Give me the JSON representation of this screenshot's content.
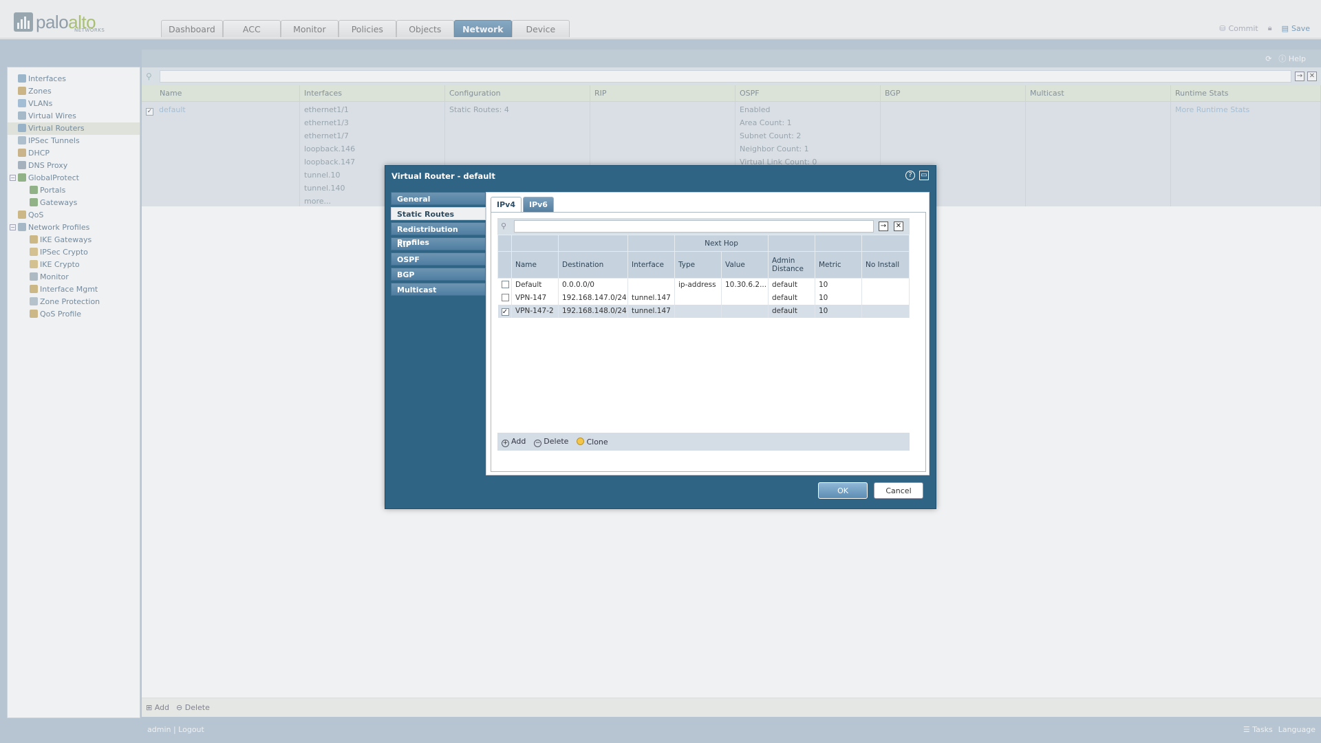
{
  "header": {
    "logo_word_a": "palo",
    "logo_word_b": "alto",
    "logo_sub": "NETWORKS",
    "tabs": [
      "Dashboard",
      "ACC",
      "Monitor",
      "Policies",
      "Objects",
      "Network",
      "Device"
    ],
    "active_tab": "Network",
    "commit_label": "Commit",
    "save_label": "Save"
  },
  "main_toolbar": {
    "help_label": "Help"
  },
  "sidebar": {
    "items": [
      {
        "label": "Interfaces",
        "icon": "interfaces-icon",
        "level": 0
      },
      {
        "label": "Zones",
        "icon": "zones-icon",
        "level": 0
      },
      {
        "label": "VLANs",
        "icon": "vlans-icon",
        "level": 0
      },
      {
        "label": "Virtual Wires",
        "icon": "virtual-wires-icon",
        "level": 0
      },
      {
        "label": "Virtual Routers",
        "icon": "virtual-routers-icon",
        "level": 0,
        "selected": true
      },
      {
        "label": "IPSec Tunnels",
        "icon": "ipsec-tunnels-icon",
        "level": 0
      },
      {
        "label": "DHCP",
        "icon": "dhcp-icon",
        "level": 0
      },
      {
        "label": "DNS Proxy",
        "icon": "dns-proxy-icon",
        "level": 0
      },
      {
        "label": "GlobalProtect",
        "icon": "globalprotect-icon",
        "level": 0,
        "toggle": "−"
      },
      {
        "label": "Portals",
        "icon": "portals-icon",
        "level": 1
      },
      {
        "label": "Gateways",
        "icon": "gateways-icon",
        "level": 1
      },
      {
        "label": "QoS",
        "icon": "qos-icon",
        "level": 0
      },
      {
        "label": "Network Profiles",
        "icon": "network-profiles-icon",
        "level": 0,
        "toggle": "−"
      },
      {
        "label": "IKE Gateways",
        "icon": "ike-gateways-icon",
        "level": 1
      },
      {
        "label": "IPSec Crypto",
        "icon": "ipsec-crypto-icon",
        "level": 1
      },
      {
        "label": "IKE Crypto",
        "icon": "ike-crypto-icon",
        "level": 1
      },
      {
        "label": "Monitor",
        "icon": "monitor-icon",
        "level": 1
      },
      {
        "label": "Interface Mgmt",
        "icon": "interface-mgmt-icon",
        "level": 1
      },
      {
        "label": "Zone Protection",
        "icon": "zone-protection-icon",
        "level": 1
      },
      {
        "label": "QoS Profile",
        "icon": "qos-profile-icon",
        "level": 1
      }
    ]
  },
  "router_grid": {
    "columns": [
      "Name",
      "Interfaces",
      "Configuration",
      "RIP",
      "OSPF",
      "BGP",
      "Multicast",
      "Runtime Stats"
    ],
    "row": {
      "name": "default",
      "interfaces": [
        "ethernet1/1",
        "ethernet1/3",
        "ethernet1/7",
        "loopback.146",
        "loopback.147",
        "tunnel.10",
        "tunnel.140",
        "more..."
      ],
      "configuration": "Static Routes: 4",
      "rip": "",
      "ospf": [
        "Enabled",
        "Area Count: 1",
        "Subnet Count: 2",
        "Neighbor Count: 1",
        "Virtual Link Count: 0"
      ],
      "bgp": "",
      "multicast": "",
      "runtime_stats": "More Runtime Stats"
    }
  },
  "bottom_bar": {
    "add_label": "Add",
    "delete_label": "Delete"
  },
  "status_bar": {
    "user": "admin",
    "logout": "Logout",
    "tasks": "Tasks",
    "language": "Language"
  },
  "modal": {
    "title": "Virtual Router - default",
    "nav": [
      "General",
      "Static Routes",
      "Redistribution Profiles",
      "RIP",
      "OSPF",
      "BGP",
      "Multicast"
    ],
    "active_nav": "Static Routes",
    "tabs": [
      "IPv4",
      "IPv6"
    ],
    "active_tab": "IPv4",
    "table": {
      "group_header": "Next Hop",
      "columns": [
        "Name",
        "Destination",
        "Interface",
        "Type",
        "Value",
        "Admin Distance",
        "Metric",
        "No Install"
      ],
      "rows": [
        {
          "checked": false,
          "name": "Default",
          "destination": "0.0.0.0/0",
          "interface": "",
          "type": "ip-address",
          "value": "10.30.6.2...",
          "admin_distance": "default",
          "metric": "10",
          "no_install": ""
        },
        {
          "checked": false,
          "name": "VPN-147",
          "destination": "192.168.147.0/24",
          "interface": "tunnel.147",
          "type": "",
          "value": "",
          "admin_distance": "default",
          "metric": "10",
          "no_install": ""
        },
        {
          "checked": true,
          "name": "VPN-147-2",
          "destination": "192.168.148.0/24",
          "interface": "tunnel.147",
          "type": "",
          "value": "",
          "admin_distance": "default",
          "metric": "10",
          "no_install": ""
        }
      ]
    },
    "actions": {
      "add": "Add",
      "delete": "Delete",
      "clone": "Clone"
    },
    "ok_label": "OK",
    "cancel_label": "Cancel"
  }
}
